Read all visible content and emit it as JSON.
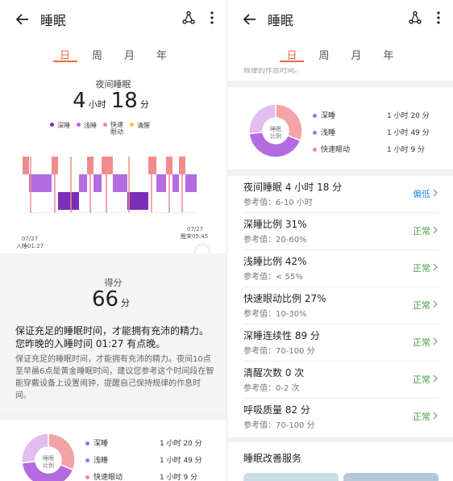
{
  "app": {
    "title": "睡眠"
  },
  "tabs": [
    "日",
    "周",
    "月",
    "年"
  ],
  "summary": {
    "label": "夜间睡眠",
    "hours": "4",
    "hours_unit": "小时",
    "minutes": "18",
    "minutes_unit": "分",
    "legend": [
      {
        "name": "深睡",
        "color": "#7a2fb8"
      },
      {
        "name": "浅睡",
        "color": "#b46be0"
      },
      {
        "name": "快速\n眼动",
        "color": "#f28b8e"
      },
      {
        "name": "清醒",
        "color": "#f5c431"
      }
    ],
    "start_date": "07/27",
    "start_text": "入睡01:27",
    "end_date": "07/27",
    "end_text": "醒来05:45"
  },
  "score": {
    "label": "得分",
    "value": "66",
    "unit": "分",
    "headline": "保证充足的睡眠时间，才能拥有充沛的精力。您昨晚的入睡时间 01:27 有点晚。",
    "detail": "保证充足的睡眠时间，才能拥有充沛的精力。夜间10点至早晨6点是黄金睡眠时间，建议您参考这个时间段在智能穿戴设备上设置闹钟，提醒自己保持规律的作息时间。"
  },
  "ratio": {
    "center_label": "睡眠\n比例",
    "items": [
      {
        "name": "深睡",
        "value": "1 小时 20 分",
        "color": "#f4a3a6"
      },
      {
        "name": "浅睡",
        "value": "1 小时 49 分",
        "color": "#b46be0"
      },
      {
        "name": "快速眼动",
        "value": "1 小时 9 分",
        "color": "#f28b8e"
      }
    ],
    "chart_data": {
      "type": "pie",
      "labels": [
        "深睡",
        "浅睡",
        "快速眼动"
      ],
      "values": [
        80,
        109,
        69
      ],
      "colors": [
        "#f4a3a6",
        "#b46be0",
        "#e1bdf0"
      ]
    }
  },
  "right_partial_text": "规律的作息时间。",
  "metrics": [
    {
      "title": "夜间睡眠  4 小时 18 分",
      "ref": "参考值：6-10 小时",
      "status": "偏低",
      "status_color": "#2b8be8"
    },
    {
      "title": "深睡比例  31%",
      "ref": "参考值：20-60%",
      "status": "正常",
      "status_color": "#43a346"
    },
    {
      "title": "浅睡比例  42%",
      "ref": "参考值：< 55%",
      "status": "正常",
      "status_color": "#43a346"
    },
    {
      "title": "快速眼动比例  27%",
      "ref": "参考值：10-30%",
      "status": "正常",
      "status_color": "#43a346"
    },
    {
      "title": "深睡连续性  89 分",
      "ref": "参考值：70-100 分",
      "status": "正常",
      "status_color": "#43a346"
    },
    {
      "title": "清醒次数  0 次",
      "ref": "参考值：0-2 次",
      "status": "正常",
      "status_color": "#43a346"
    },
    {
      "title": "呼吸质量  82 分",
      "ref": "参考值：70-100 分",
      "status": "正常",
      "status_color": "#43a346"
    }
  ],
  "service": {
    "title": "睡眠改善服务"
  }
}
